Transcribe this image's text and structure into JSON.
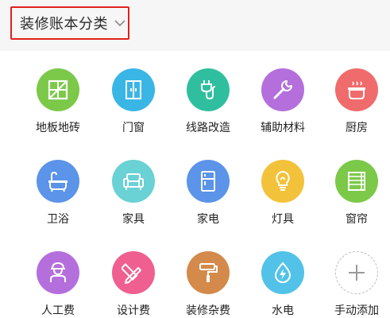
{
  "header": {
    "title": "装修账本分类",
    "dropdown_icon": "chevron-down-icon"
  },
  "categories": [
    {
      "label": "地板地砖",
      "icon": "floor-tile-icon",
      "color": "#7cc94a"
    },
    {
      "label": "门窗",
      "icon": "door-window-icon",
      "color": "#3ab6e6"
    },
    {
      "label": "线路改造",
      "icon": "wiring-plug-icon",
      "color": "#2fbf9f"
    },
    {
      "label": "辅助材料",
      "icon": "wrench-icon",
      "color": "#b46fdc"
    },
    {
      "label": "厨房",
      "icon": "cooking-pot-icon",
      "color": "#f06b6b"
    },
    {
      "label": "卫浴",
      "icon": "bathtub-icon",
      "color": "#5b94e8"
    },
    {
      "label": "家具",
      "icon": "sofa-icon",
      "color": "#6ad1d5"
    },
    {
      "label": "家电",
      "icon": "refrigerator-icon",
      "color": "#5b94e8"
    },
    {
      "label": "灯具",
      "icon": "light-bulb-icon",
      "color": "#f3c23b"
    },
    {
      "label": "窗帘",
      "icon": "curtain-icon",
      "color": "#7cc94a"
    },
    {
      "label": "人工费",
      "icon": "worker-icon",
      "color": "#b46fdc"
    },
    {
      "label": "设计费",
      "icon": "pencil-ruler-icon",
      "color": "#ef5f8f"
    },
    {
      "label": "装修杂费",
      "icon": "paint-roller-icon",
      "color": "#d48a4a"
    },
    {
      "label": "水电",
      "icon": "water-drop-bolt-icon",
      "color": "#52c2e8"
    },
    {
      "label": "手动添加",
      "icon": "plus-icon",
      "color": "#ffffff"
    }
  ]
}
